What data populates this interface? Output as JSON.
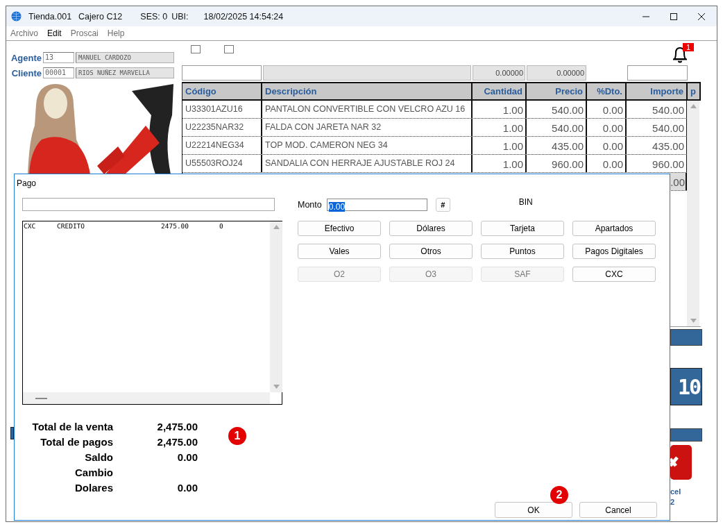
{
  "window": {
    "title_parts": [
      "Tienda.001",
      "Cajero C12",
      "SES: 0",
      "UBI:",
      "18/02/2025 14:54:24"
    ]
  },
  "menu": [
    {
      "label": "Archivo",
      "disabled": true
    },
    {
      "label": "Edit",
      "disabled": false
    },
    {
      "label": "Proscai",
      "disabled": true
    },
    {
      "label": "Help",
      "disabled": true
    }
  ],
  "checkboxes": [
    {
      "checked": false
    },
    {
      "checked": false
    }
  ],
  "notifications": {
    "count": "1"
  },
  "agent": {
    "label": "Agente",
    "code": "13",
    "name": "MANUEL CARDOZO"
  },
  "client": {
    "label": "Cliente",
    "code": "00001",
    "name": "RIOS NUÑEZ MARVELLA"
  },
  "summary_fields": [
    {
      "kind": "input"
    },
    {
      "kind": "readonly"
    },
    {
      "kind": "readonly",
      "value": "0.00000"
    },
    {
      "kind": "readonly",
      "value": "0.00000"
    },
    {
      "kind": "spacer"
    },
    {
      "kind": "input"
    }
  ],
  "table": {
    "columns": [
      "Código",
      "Descripción",
      "Cantidad",
      "Precio",
      "%Dto.",
      "Importe",
      "p"
    ],
    "rows": [
      [
        "U33301AZU16",
        "PANTALON CONVERTIBLE CON VELCRO AZU 16",
        "1.00",
        "540.00",
        "0.00",
        "540.00"
      ],
      [
        "U22235NAR32",
        "FALDA CON JARETA NAR 32",
        "1.00",
        "540.00",
        "0.00",
        "540.00"
      ],
      [
        "U22214NEG34",
        "TOP MOD. CAMERON NEG 34",
        "1.00",
        "435.00",
        "0.00",
        "435.00"
      ],
      [
        "U55503ROJ24",
        "SANDALIA CON HERRAJE AJUSTABLE ROJ 24",
        "1.00",
        "960.00",
        "0.00",
        "960.00"
      ]
    ],
    "partial_row": {
      "importe": ".00",
      "selected": true
    }
  },
  "side_panel": {
    "display": "10",
    "caption_lines": [
      "cel",
      "2"
    ]
  },
  "dialog": {
    "title": "Pago",
    "payments": [
      {
        "type": "CXC",
        "description": "CREDITO",
        "amount": "2475.00",
        "column_4": "0"
      }
    ],
    "amount": {
      "label": "Monto",
      "value": "0.00"
    },
    "hash_button": "#",
    "bin_label": "BIN",
    "methods": [
      {
        "label": "Efectivo",
        "disabled": false
      },
      {
        "label": "Dólares",
        "disabled": false
      },
      {
        "label": "Tarjeta",
        "disabled": false
      },
      {
        "label": "Apartados",
        "disabled": false
      },
      {
        "label": "Vales",
        "disabled": false
      },
      {
        "label": "Otros",
        "disabled": false
      },
      {
        "label": "Puntos",
        "disabled": false
      },
      {
        "label": "Pagos Digitales",
        "disabled": false
      },
      {
        "label": "O2",
        "disabled": true
      },
      {
        "label": "O3",
        "disabled": true
      },
      {
        "label": "SAF",
        "disabled": true
      },
      {
        "label": "CXC",
        "disabled": false
      }
    ],
    "totals": [
      {
        "label": "Total de la venta",
        "value": "2,475.00"
      },
      {
        "label": "Total de pagos",
        "value": "2,475.00"
      },
      {
        "label": "Saldo",
        "value": "0.00"
      },
      {
        "label": "Cambio"
      },
      {
        "label": "Dolares",
        "value": "0.00"
      }
    ],
    "buttons": [
      "OK",
      "Cancel"
    ]
  },
  "annotations": [
    {
      "number": "1"
    },
    {
      "number": "2"
    }
  ]
}
